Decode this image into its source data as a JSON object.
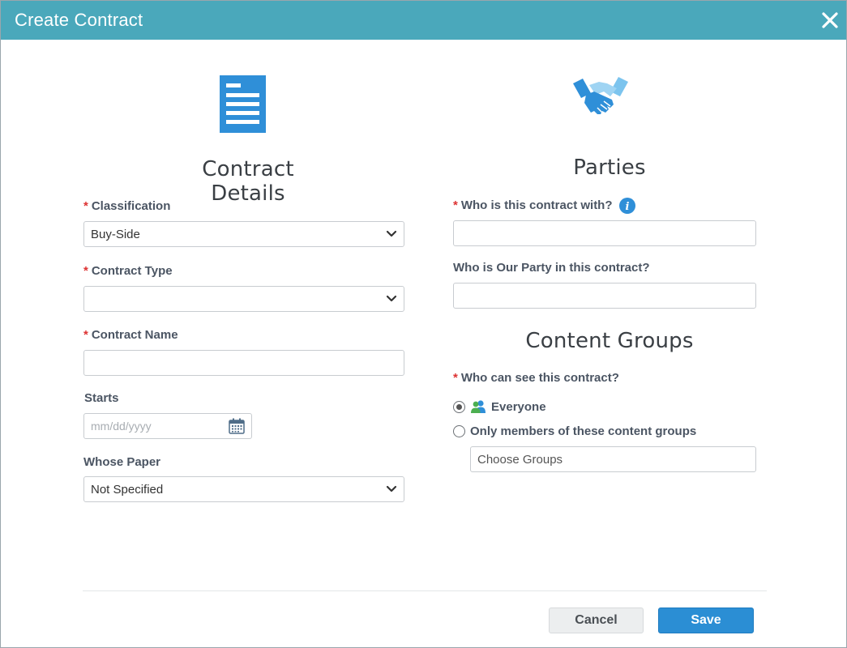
{
  "dialog": {
    "title": "Create Contract"
  },
  "contract_details": {
    "heading": "Contract Details",
    "classification": {
      "label": "Classification",
      "value": "Buy-Side"
    },
    "contract_type": {
      "label": "Contract Type",
      "value": ""
    },
    "contract_name": {
      "label": "Contract Name",
      "value": ""
    },
    "starts": {
      "label": "Starts",
      "placeholder": "mm/dd/yyyy"
    },
    "whose_paper": {
      "label": "Whose Paper",
      "value": "Not Specified"
    }
  },
  "parties": {
    "heading": "Parties",
    "who_with": {
      "label": "Who is this contract with?",
      "value": ""
    },
    "our_party": {
      "label": "Who is Our Party in this contract?",
      "value": ""
    }
  },
  "content_groups": {
    "heading": "Content Groups",
    "visibility_label": "Who can see this contract?",
    "options": [
      {
        "label": "Everyone",
        "checked": true
      },
      {
        "label": "Only members of these content groups",
        "checked": false
      }
    ],
    "choose_groups": "Choose Groups"
  },
  "footer": {
    "cancel_label": "Cancel",
    "save_label": "Save"
  },
  "required_marker": "*",
  "colors": {
    "titlebar": "#4aa8bb",
    "primary": "#2b8ed4",
    "required": "#dd3333"
  },
  "icons": {
    "close": "close-icon",
    "document": "document-icon",
    "handshake": "handshake-icon",
    "chevron": "chevron-down-icon",
    "calendar": "calendar-icon",
    "info": "info-icon",
    "users": "users-icon"
  }
}
